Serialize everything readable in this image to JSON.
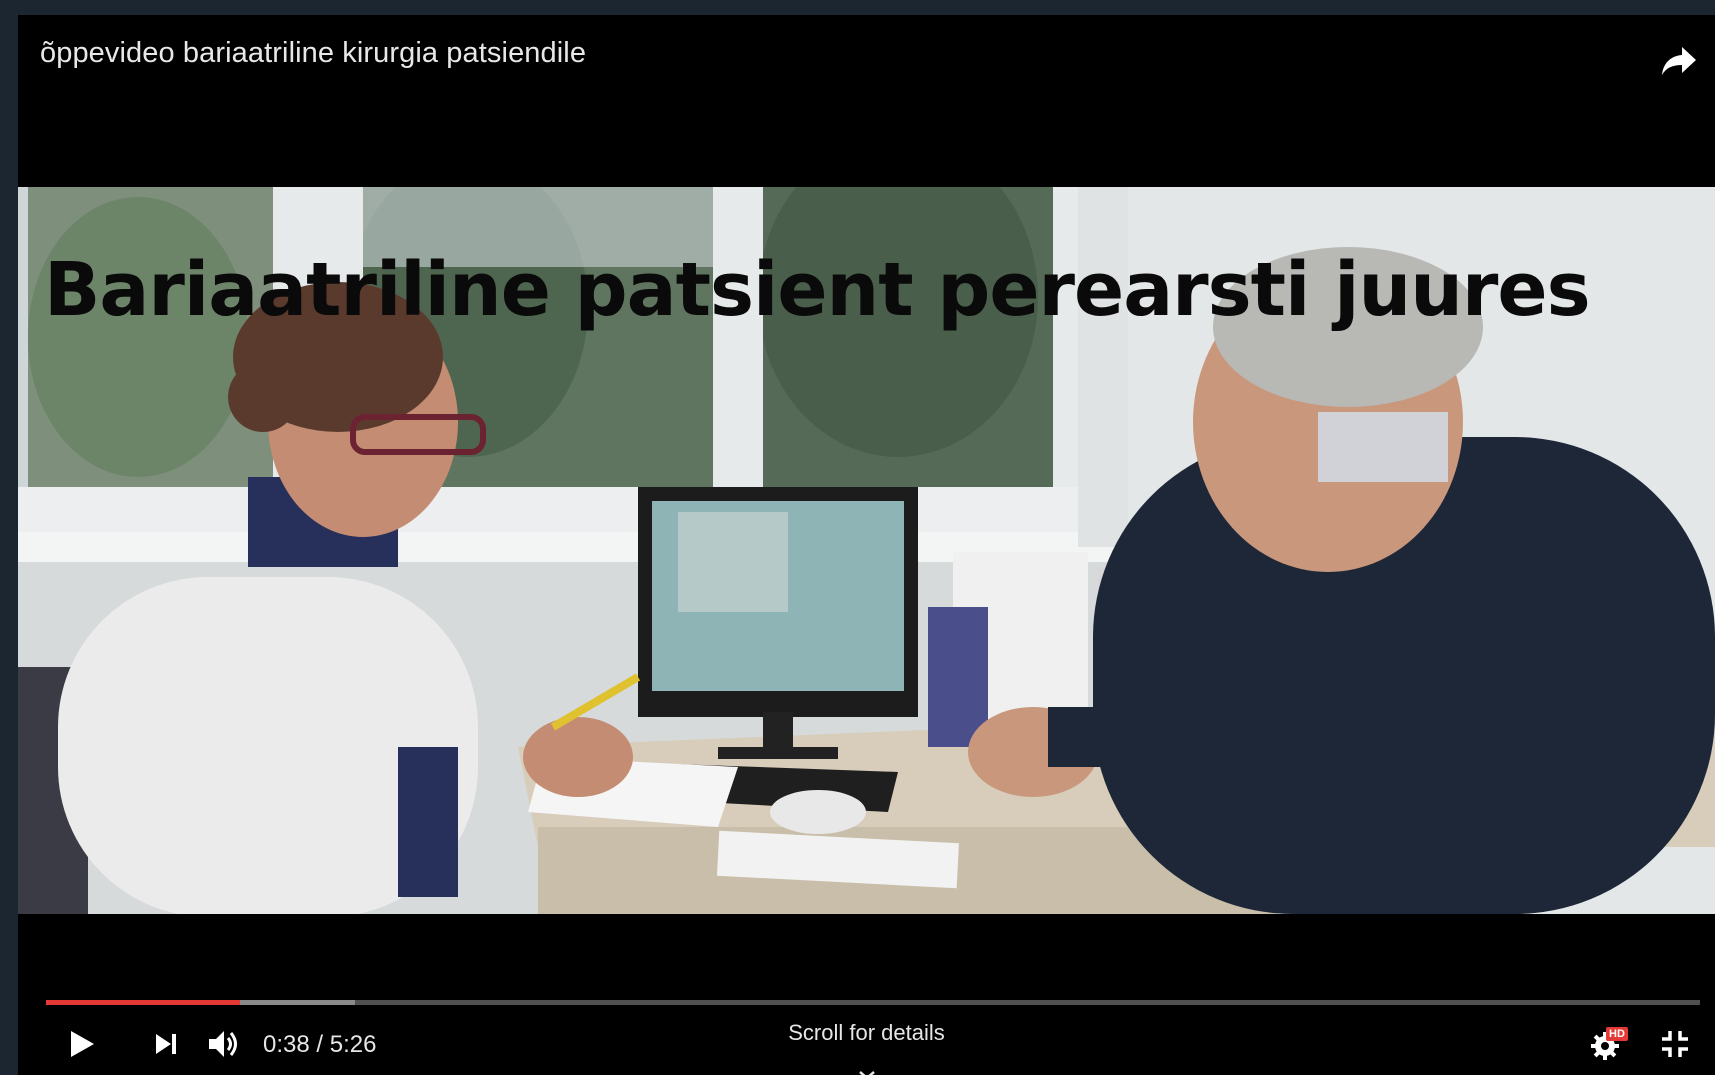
{
  "video": {
    "title": "õppevideo bariaatriline kirurgia patsiendile",
    "overlay_title": "Bariaatriline patsient perearsti juures"
  },
  "controls": {
    "current_time": "0:38",
    "separator": "/",
    "duration": "5:26",
    "progress_played_fraction": 0.117,
    "progress_buffered_fraction": 0.187,
    "scroll_hint": "Scroll for details",
    "hd_badge": "HD"
  },
  "icons": {
    "share": "share-icon",
    "play": "play-icon",
    "next": "next-icon",
    "volume": "volume-icon",
    "settings": "gear-icon",
    "exit_fullscreen": "exit-fullscreen-icon",
    "scroll": "chevron-down-icon"
  },
  "colors": {
    "progress_played": "#e53935",
    "player_bg": "#000000",
    "page_bg": "#1b2631"
  }
}
